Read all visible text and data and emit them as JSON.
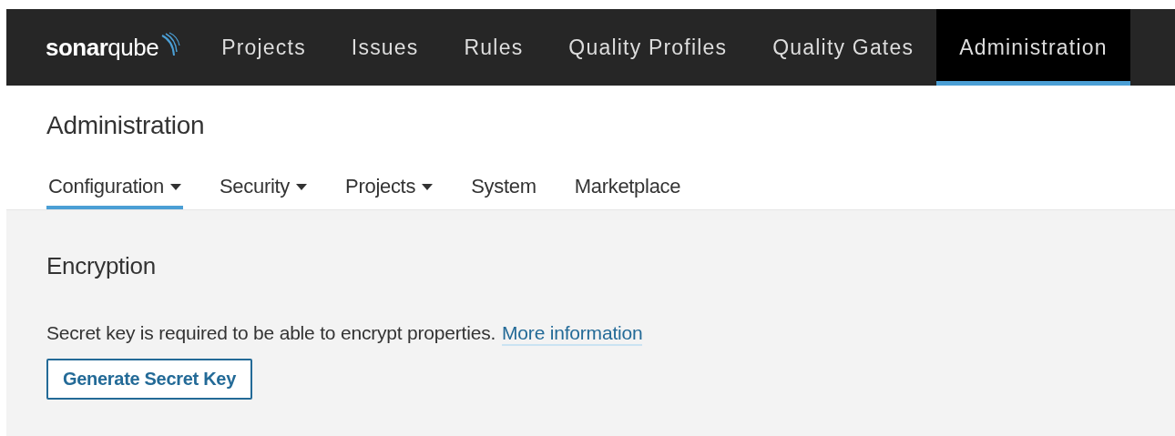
{
  "navbar": {
    "logo": "**sonar**qube",
    "items": [
      {
        "label": "Projects",
        "selected": false
      },
      {
        "label": "Issues",
        "selected": false
      },
      {
        "label": "Rules",
        "selected": false
      },
      {
        "label": "Quality Profiles",
        "selected": false
      },
      {
        "label": "Quality Gates",
        "selected": false
      },
      {
        "label": "Administration",
        "selected": true
      }
    ]
  },
  "page_title": "Administration",
  "subnav": [
    {
      "label": "Configuration",
      "dropdown": true,
      "selected": true
    },
    {
      "label": "Security",
      "dropdown": true,
      "selected": false
    },
    {
      "label": "Projects",
      "dropdown": true,
      "selected": false
    },
    {
      "label": "System",
      "dropdown": false,
      "selected": false
    },
    {
      "label": "Marketplace",
      "dropdown": false,
      "selected": false
    }
  ],
  "section": {
    "title": "Encryption",
    "text": "Secret key is required to be able to encrypt properties.",
    "link": "More information",
    "button": "Generate Secret Key"
  }
}
